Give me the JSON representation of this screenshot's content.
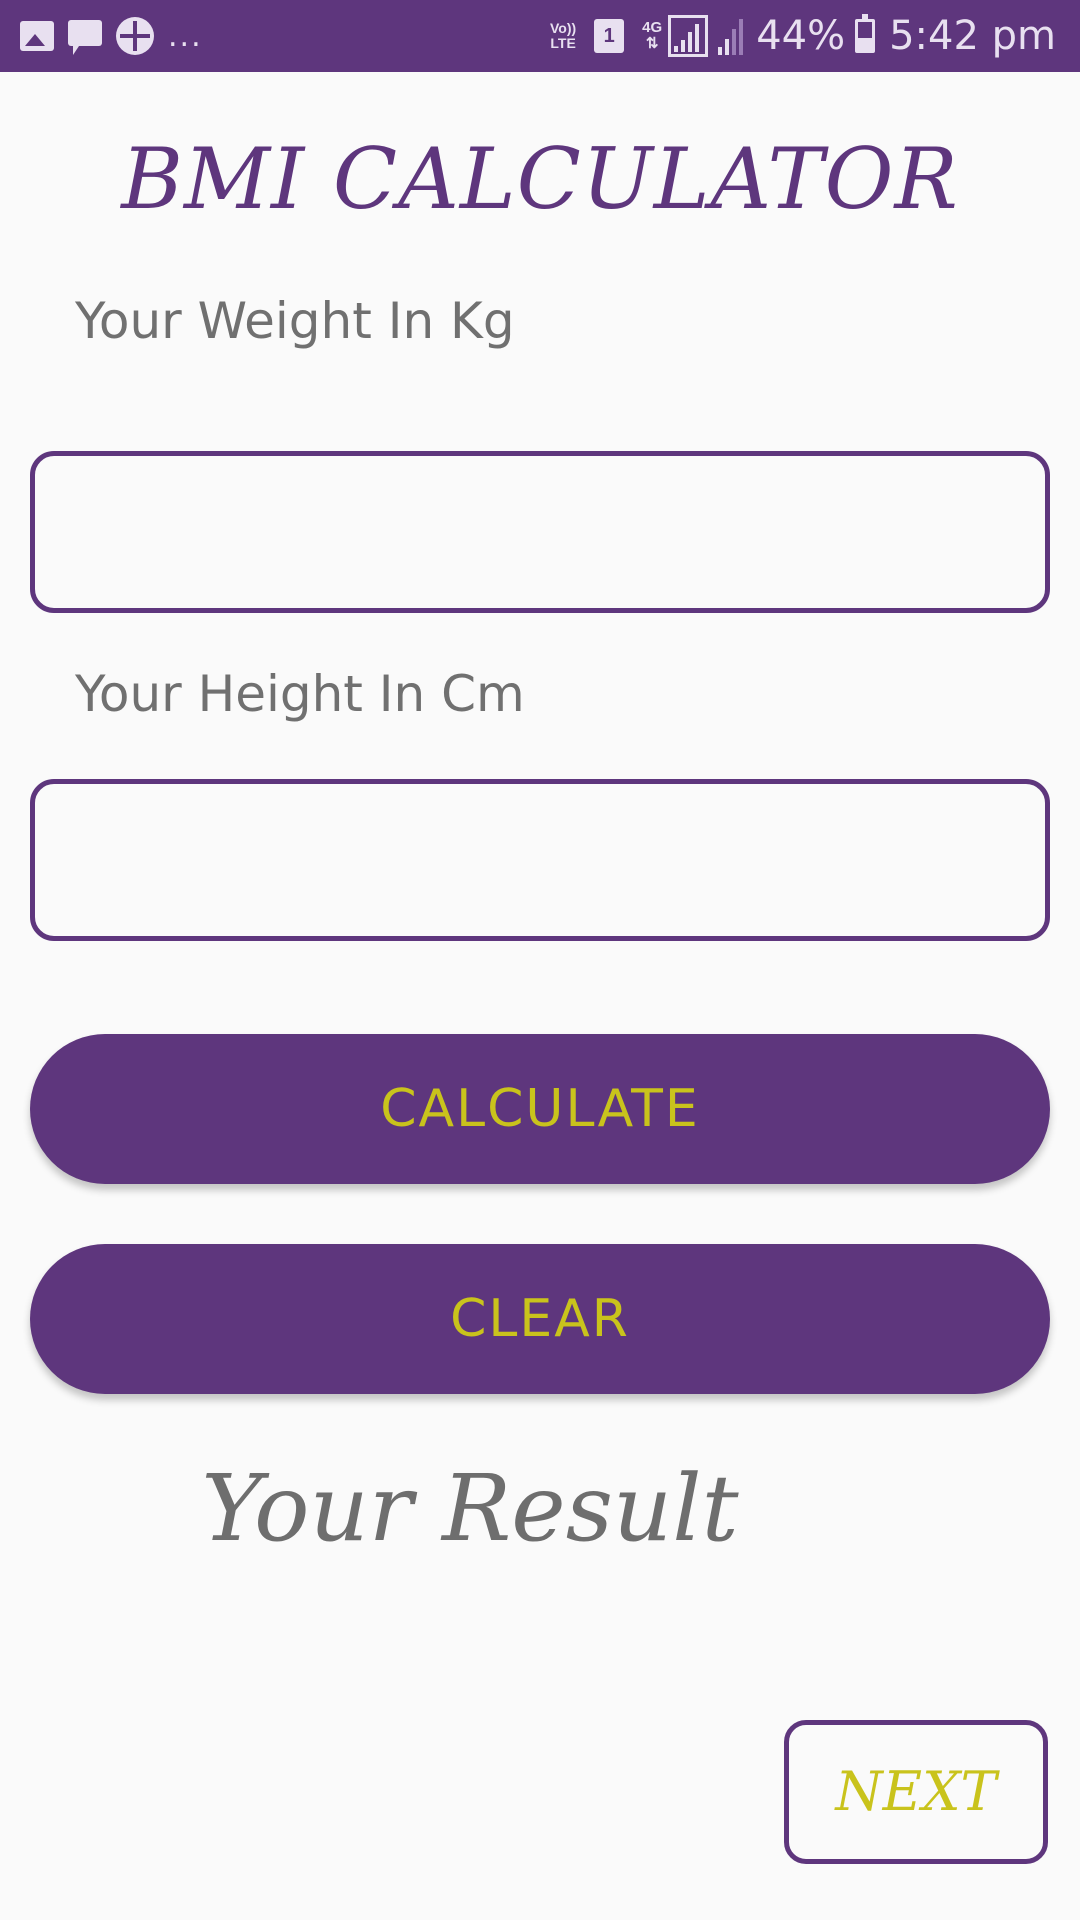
{
  "status_bar": {
    "left_icons": [
      "gallery-icon",
      "chat-icon",
      "clover-icon"
    ],
    "more": "...",
    "volte_line1": "Vo))",
    "volte_line2": "LTE",
    "sim": "1",
    "network": "4G",
    "battery": "44%",
    "battery_level": 0.44,
    "time": "5:42 pm"
  },
  "app": {
    "title": "BMI CALCULATOR",
    "weight_label": "Your Weight In Kg",
    "weight_value": "",
    "height_label": "Your Height In Cm",
    "height_value": "",
    "calculate_label": "CALCULATE",
    "clear_label": "CLEAR",
    "result_label": "Your Result",
    "next_label": "NEXT"
  },
  "colors": {
    "primary": "#5e367d",
    "accent": "#c9c31c",
    "background": "#fafafa",
    "label_text": "#707070"
  }
}
